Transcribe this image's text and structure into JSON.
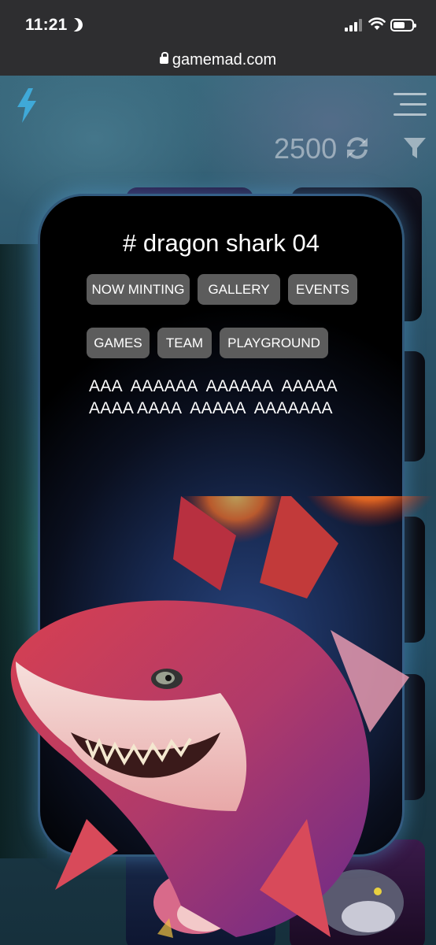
{
  "status_bar": {
    "time": "11:21"
  },
  "browser": {
    "url": "gamemad.com"
  },
  "header": {
    "credits": "2500"
  },
  "modal": {
    "title": "# dragon shark 04",
    "nav": [
      {
        "label": "NOW MINTING"
      },
      {
        "label": "GALLERY"
      },
      {
        "label": "EVENTS"
      },
      {
        "label": "GAMES"
      },
      {
        "label": "TEAM"
      },
      {
        "label": "PLAYGROUND"
      }
    ],
    "text_lines": [
      "AAA  AAAAAA  AAAAAA  AAAAA",
      "AAAA AAAA  AAAAA  AAAAAAA"
    ]
  },
  "colors": {
    "accent": "#3fa9d8",
    "chip_bg": "#5c5c5c",
    "card_glow": "#5aa0dc"
  },
  "icons": [
    "moon-icon",
    "signal-icon",
    "wifi-icon",
    "battery-icon",
    "lock-icon",
    "bolt-logo-icon",
    "menu-icon",
    "refresh-icon",
    "filter-icon"
  ]
}
